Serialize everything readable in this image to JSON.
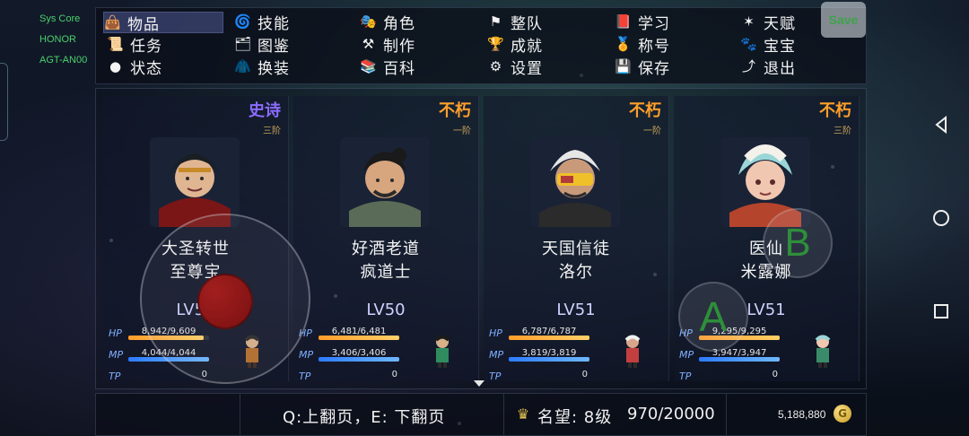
{
  "device": {
    "line1": "Sys Core",
    "line2": "HONOR",
    "line3": "AGT-AN00"
  },
  "menu": {
    "items": [
      {
        "label": "物品",
        "icon": "bag-icon",
        "active": true
      },
      {
        "label": "技能",
        "icon": "skill-icon"
      },
      {
        "label": "角色",
        "icon": "mask-icon"
      },
      {
        "label": "整队",
        "icon": "flag-icon"
      },
      {
        "label": "学习",
        "icon": "book-icon"
      },
      {
        "label": "天赋",
        "icon": "talent-icon"
      },
      {
        "label": "任务",
        "icon": "quest-scroll-icon"
      },
      {
        "label": "图鉴",
        "icon": "catalog-icon"
      },
      {
        "label": "制作",
        "icon": "craft-icon"
      },
      {
        "label": "成就",
        "icon": "trophy-icon"
      },
      {
        "label": "称号",
        "icon": "medal-icon"
      },
      {
        "label": "宝宝",
        "icon": "pet-icon"
      },
      {
        "label": "状态",
        "icon": "status-orb-icon"
      },
      {
        "label": "换装",
        "icon": "outfit-icon"
      },
      {
        "label": "百科",
        "icon": "encyclopedia-icon"
      },
      {
        "label": "设置",
        "icon": "gear-icon"
      },
      {
        "label": "保存",
        "icon": "save-disk-icon"
      },
      {
        "label": "退出",
        "icon": "exit-icon"
      }
    ]
  },
  "save_button": {
    "label": "Save"
  },
  "party": [
    {
      "rank": "史诗",
      "rank_color": "#8b6cff",
      "tier": "三阶",
      "name_line1": "大圣转世",
      "name_line2": "至尊宝",
      "level": "LV51",
      "hp_text": "8,942/9,609",
      "hp_ratio": 0.93,
      "mp_text": "4,044/4,044",
      "mp_ratio": 1.0,
      "tp_label": "TP",
      "tp_value": "0"
    },
    {
      "rank": "不朽",
      "rank_color": "#ff9f2b",
      "tier": "一阶",
      "name_line1": "好酒老道",
      "name_line2": "疯道士",
      "level": "LV50",
      "hp_text": "6,481/6,481",
      "hp_ratio": 1.0,
      "mp_text": "3,406/3,406",
      "mp_ratio": 1.0,
      "tp_label": "TP",
      "tp_value": "0"
    },
    {
      "rank": "不朽",
      "rank_color": "#ff9f2b",
      "tier": "一阶",
      "name_line1": "天国信徒",
      "name_line2": "洛尔",
      "level": "LV51",
      "hp_text": "6,787/6,787",
      "hp_ratio": 1.0,
      "mp_text": "3,819/3,819",
      "mp_ratio": 1.0,
      "tp_label": "TP",
      "tp_value": "0"
    },
    {
      "rank": "不朽",
      "rank_color": "#ff9f2b",
      "tier": "三阶",
      "name_line1": "医仙",
      "name_line2": "米露娜",
      "level": "LV51",
      "hp_text": "9,295/9,295",
      "hp_ratio": 1.0,
      "mp_text": "3,947/3,947",
      "mp_ratio": 1.0,
      "tp_label": "TP",
      "tp_value": "0"
    }
  ],
  "stats": {
    "hp_label": "HP",
    "mp_label": "MP"
  },
  "bottom": {
    "page_hint": "Q:上翻页，E: 下翻页",
    "reputation": "名望: 8级",
    "reputation_progress": "970/20000",
    "gold": "5,188,880",
    "gold_icon": "G"
  },
  "overlay": {
    "btn_a": "A",
    "btn_b": "B"
  }
}
